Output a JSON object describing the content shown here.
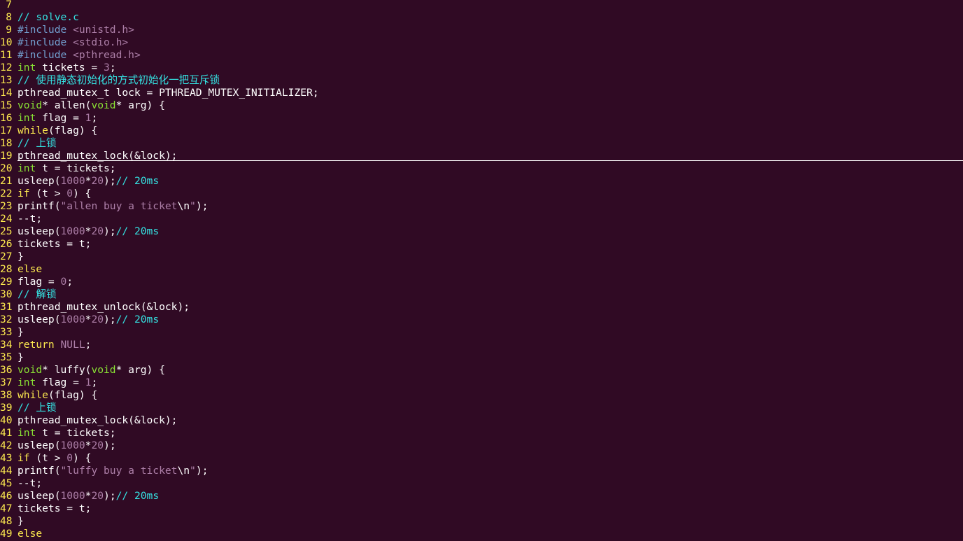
{
  "editor": {
    "filename_comment": "// solve.c",
    "lines": [
      {
        "n": "7",
        "tokens": []
      },
      {
        "n": "8",
        "tokens": [
          {
            "c": "comment",
            "t": "// solve.c"
          }
        ]
      },
      {
        "n": "9",
        "tokens": [
          {
            "c": "preproc",
            "t": "#include "
          },
          {
            "c": "include",
            "t": "<unistd.h>"
          }
        ]
      },
      {
        "n": "10",
        "tokens": [
          {
            "c": "preproc",
            "t": "#include "
          },
          {
            "c": "include",
            "t": "<stdio.h>"
          }
        ]
      },
      {
        "n": "11",
        "tokens": [
          {
            "c": "preproc",
            "t": "#include "
          },
          {
            "c": "include",
            "t": "<pthread.h>"
          }
        ]
      },
      {
        "n": "12",
        "tokens": [
          {
            "c": "type",
            "t": "int"
          },
          {
            "c": "text",
            "t": " tickets = "
          },
          {
            "c": "number",
            "t": "3"
          },
          {
            "c": "text",
            "t": ";"
          }
        ]
      },
      {
        "n": "13",
        "tokens": [
          {
            "c": "comment",
            "t": "// 使用静态初始化的方式初始化一把互斥锁"
          }
        ]
      },
      {
        "n": "14",
        "tokens": [
          {
            "c": "text",
            "t": "pthread_mutex_t lock = PTHREAD_MUTEX_INITIALIZER;"
          }
        ]
      },
      {
        "n": "15",
        "tokens": [
          {
            "c": "type",
            "t": "void"
          },
          {
            "c": "text",
            "t": "* allen("
          },
          {
            "c": "type",
            "t": "void"
          },
          {
            "c": "text",
            "t": "* arg) {"
          }
        ]
      },
      {
        "n": "16",
        "tokens": [
          {
            "c": "type",
            "t": "int"
          },
          {
            "c": "text",
            "t": " flag = "
          },
          {
            "c": "number",
            "t": "1"
          },
          {
            "c": "text",
            "t": ";"
          }
        ]
      },
      {
        "n": "17",
        "tokens": [
          {
            "c": "keyword",
            "t": "while"
          },
          {
            "c": "text",
            "t": "(flag) {"
          }
        ]
      },
      {
        "n": "18",
        "tokens": [
          {
            "c": "comment",
            "t": "// 上锁"
          }
        ]
      },
      {
        "n": "19",
        "cursor": true,
        "tokens": [
          {
            "c": "text",
            "t": "pthread_mutex_lock(&lock);"
          }
        ]
      },
      {
        "n": "20",
        "tokens": [
          {
            "c": "type",
            "t": "int"
          },
          {
            "c": "text",
            "t": " t = tickets;"
          }
        ]
      },
      {
        "n": "21",
        "tokens": [
          {
            "c": "text",
            "t": "usleep("
          },
          {
            "c": "number",
            "t": "1000"
          },
          {
            "c": "text",
            "t": "*"
          },
          {
            "c": "number",
            "t": "20"
          },
          {
            "c": "text",
            "t": ");"
          },
          {
            "c": "comment",
            "t": "// 20ms"
          }
        ]
      },
      {
        "n": "22",
        "tokens": [
          {
            "c": "keyword",
            "t": "if"
          },
          {
            "c": "text",
            "t": " (t > "
          },
          {
            "c": "number",
            "t": "0"
          },
          {
            "c": "text",
            "t": ") {"
          }
        ]
      },
      {
        "n": "23",
        "tokens": [
          {
            "c": "text",
            "t": "printf("
          },
          {
            "c": "string",
            "t": "\"allen buy a ticket"
          },
          {
            "c": "escape",
            "t": "\\n"
          },
          {
            "c": "string",
            "t": "\""
          },
          {
            "c": "text",
            "t": ");"
          }
        ]
      },
      {
        "n": "24",
        "tokens": [
          {
            "c": "text",
            "t": "--t;"
          }
        ]
      },
      {
        "n": "25",
        "tokens": [
          {
            "c": "text",
            "t": "usleep("
          },
          {
            "c": "number",
            "t": "1000"
          },
          {
            "c": "text",
            "t": "*"
          },
          {
            "c": "number",
            "t": "20"
          },
          {
            "c": "text",
            "t": ");"
          },
          {
            "c": "comment",
            "t": "// 20ms"
          }
        ]
      },
      {
        "n": "26",
        "tokens": [
          {
            "c": "text",
            "t": "tickets = t;"
          }
        ]
      },
      {
        "n": "27",
        "tokens": [
          {
            "c": "text",
            "t": "}"
          }
        ]
      },
      {
        "n": "28",
        "tokens": [
          {
            "c": "keyword",
            "t": "else"
          }
        ]
      },
      {
        "n": "29",
        "tokens": [
          {
            "c": "text",
            "t": "flag = "
          },
          {
            "c": "number",
            "t": "0"
          },
          {
            "c": "text",
            "t": ";"
          }
        ]
      },
      {
        "n": "30",
        "tokens": [
          {
            "c": "comment",
            "t": "// 解锁"
          }
        ]
      },
      {
        "n": "31",
        "tokens": [
          {
            "c": "text",
            "t": "pthread_mutex_unlock(&lock);"
          }
        ]
      },
      {
        "n": "32",
        "tokens": [
          {
            "c": "text",
            "t": "usleep("
          },
          {
            "c": "number",
            "t": "1000"
          },
          {
            "c": "text",
            "t": "*"
          },
          {
            "c": "number",
            "t": "20"
          },
          {
            "c": "text",
            "t": ");"
          },
          {
            "c": "comment",
            "t": "// 20ms"
          }
        ]
      },
      {
        "n": "33",
        "tokens": [
          {
            "c": "text",
            "t": "}"
          }
        ]
      },
      {
        "n": "34",
        "tokens": [
          {
            "c": "keyword",
            "t": "return"
          },
          {
            "c": "text",
            "t": " "
          },
          {
            "c": "constant",
            "t": "NULL"
          },
          {
            "c": "text",
            "t": ";"
          }
        ]
      },
      {
        "n": "35",
        "tokens": [
          {
            "c": "text",
            "t": "}"
          }
        ]
      },
      {
        "n": "36",
        "tokens": [
          {
            "c": "type",
            "t": "void"
          },
          {
            "c": "text",
            "t": "* luffy("
          },
          {
            "c": "type",
            "t": "void"
          },
          {
            "c": "text",
            "t": "* arg) {"
          }
        ]
      },
      {
        "n": "37",
        "tokens": [
          {
            "c": "type",
            "t": "int"
          },
          {
            "c": "text",
            "t": " flag = "
          },
          {
            "c": "number",
            "t": "1"
          },
          {
            "c": "text",
            "t": ";"
          }
        ]
      },
      {
        "n": "38",
        "tokens": [
          {
            "c": "keyword",
            "t": "while"
          },
          {
            "c": "text",
            "t": "(flag) {"
          }
        ]
      },
      {
        "n": "39",
        "tokens": [
          {
            "c": "comment",
            "t": "// 上锁"
          }
        ]
      },
      {
        "n": "40",
        "tokens": [
          {
            "c": "text",
            "t": "pthread_mutex_lock(&lock);"
          }
        ]
      },
      {
        "n": "41",
        "tokens": [
          {
            "c": "type",
            "t": "int"
          },
          {
            "c": "text",
            "t": " t = tickets;"
          }
        ]
      },
      {
        "n": "42",
        "tokens": [
          {
            "c": "text",
            "t": "usleep("
          },
          {
            "c": "number",
            "t": "1000"
          },
          {
            "c": "text",
            "t": "*"
          },
          {
            "c": "number",
            "t": "20"
          },
          {
            "c": "text",
            "t": ");"
          }
        ]
      },
      {
        "n": "43",
        "tokens": [
          {
            "c": "keyword",
            "t": "if"
          },
          {
            "c": "text",
            "t": " (t > "
          },
          {
            "c": "number",
            "t": "0"
          },
          {
            "c": "text",
            "t": ") {"
          }
        ]
      },
      {
        "n": "44",
        "tokens": [
          {
            "c": "text",
            "t": "printf("
          },
          {
            "c": "string",
            "t": "\"luffy buy a ticket"
          },
          {
            "c": "escape",
            "t": "\\n"
          },
          {
            "c": "string",
            "t": "\""
          },
          {
            "c": "text",
            "t": ");"
          }
        ]
      },
      {
        "n": "45",
        "tokens": [
          {
            "c": "text",
            "t": "--t;"
          }
        ]
      },
      {
        "n": "46",
        "tokens": [
          {
            "c": "text",
            "t": "usleep("
          },
          {
            "c": "number",
            "t": "1000"
          },
          {
            "c": "text",
            "t": "*"
          },
          {
            "c": "number",
            "t": "20"
          },
          {
            "c": "text",
            "t": ");"
          },
          {
            "c": "comment",
            "t": "// 20ms"
          }
        ]
      },
      {
        "n": "47",
        "tokens": [
          {
            "c": "text",
            "t": "tickets = t;"
          }
        ]
      },
      {
        "n": "48",
        "tokens": [
          {
            "c": "text",
            "t": "}"
          }
        ]
      },
      {
        "n": "49",
        "tokens": [
          {
            "c": "keyword",
            "t": "else"
          }
        ]
      }
    ]
  },
  "colors": {
    "background": "#300a24",
    "line_number": "#fce94f",
    "comment": "#34e2e2",
    "type": "#8ae234",
    "keyword": "#fce94f",
    "literal": "#ad7fa8",
    "preproc": "#729fcf",
    "text": "#ffffff"
  }
}
